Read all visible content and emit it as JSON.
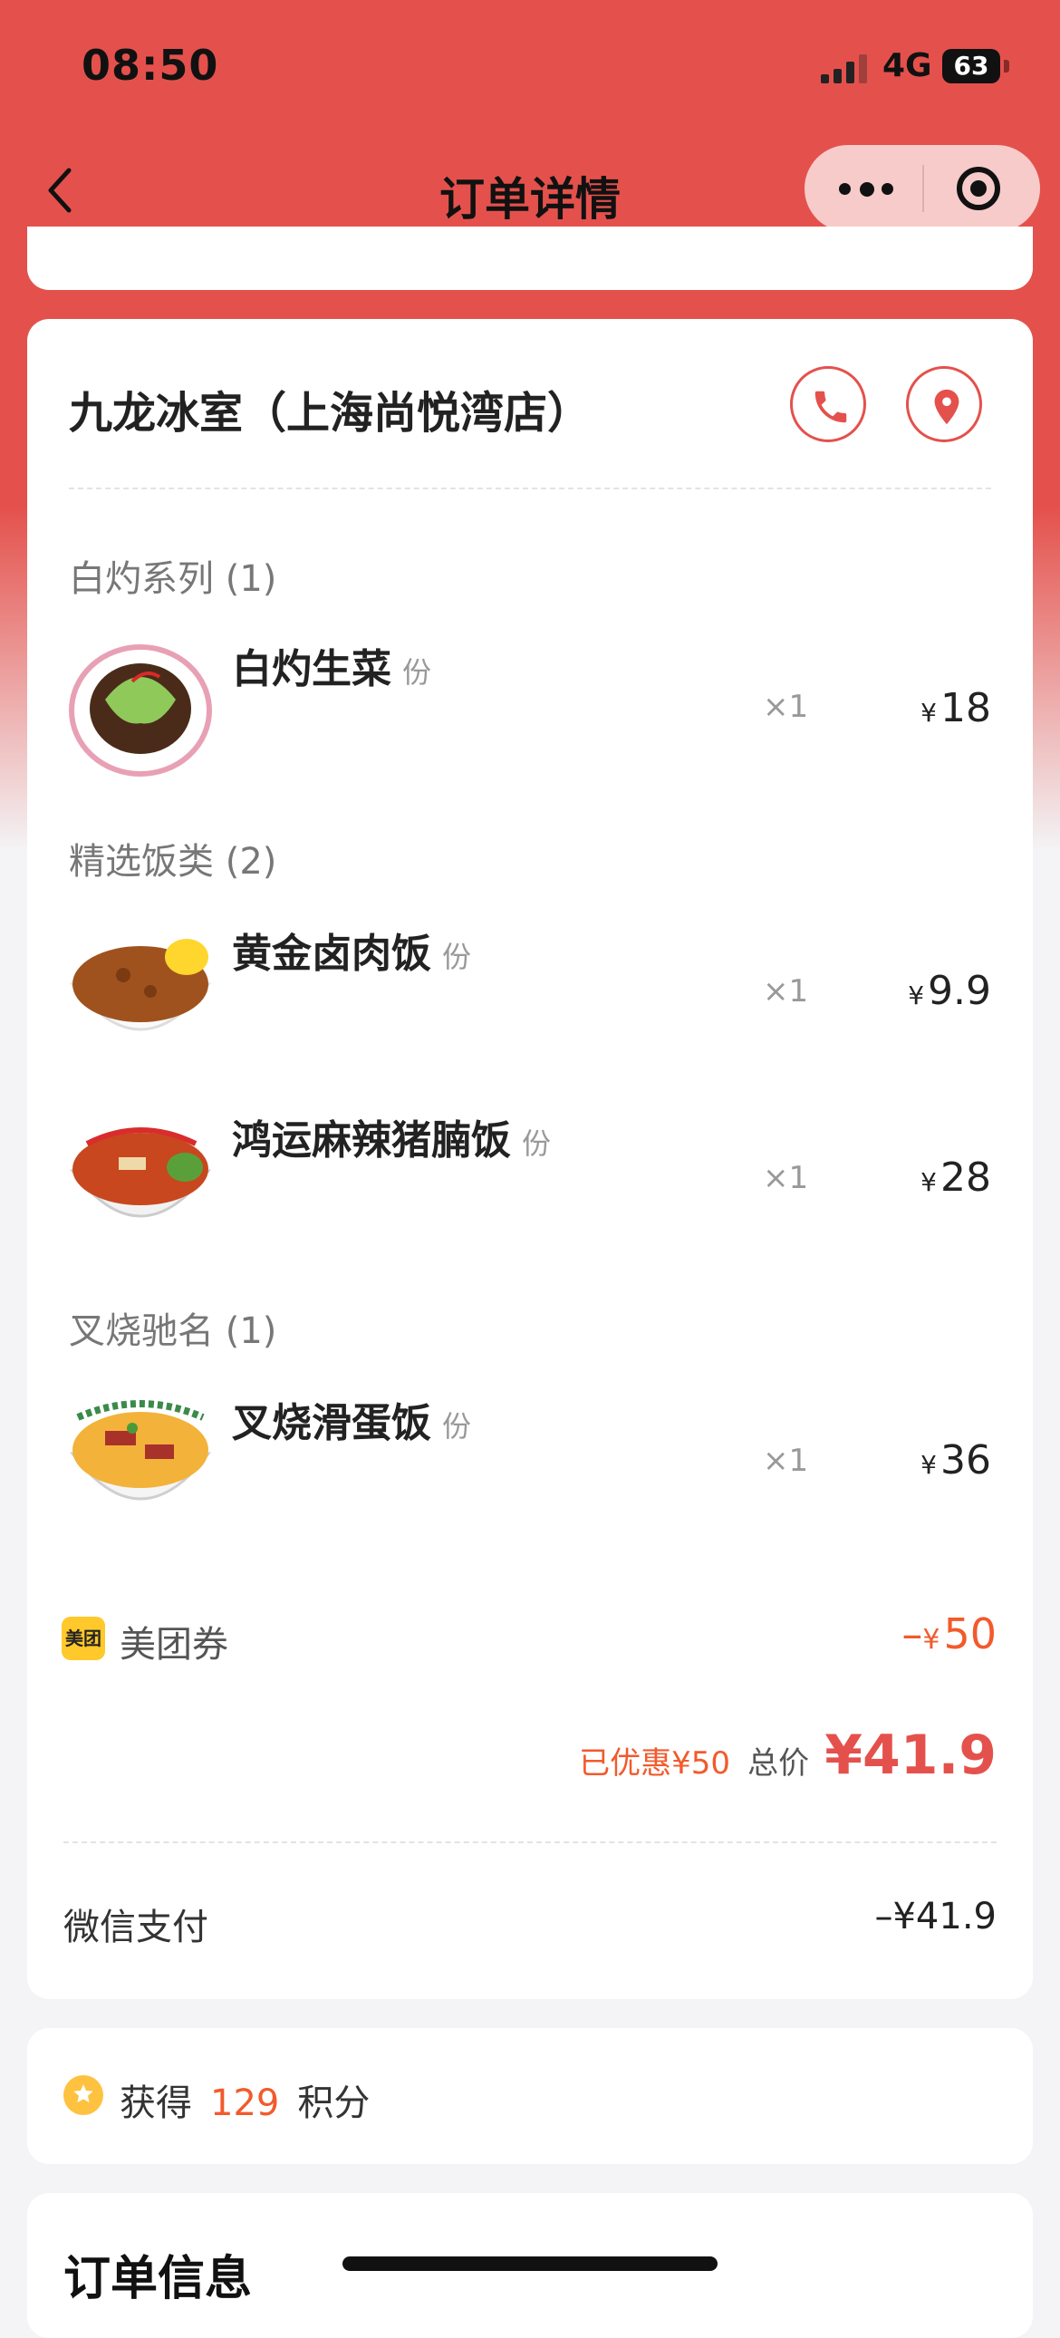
{
  "status_bar": {
    "time": "08:50",
    "network": "4G",
    "battery": "63"
  },
  "nav": {
    "title": "订单详情"
  },
  "colors": {
    "brand_red": "#e4514c",
    "accent_orange": "#f25a2c",
    "coupon_yellow": "#ffc82b"
  },
  "icons": [
    "back-icon",
    "more-icon",
    "target-icon",
    "phone-icon",
    "location-icon",
    "meituan-coupon-icon",
    "star-icon"
  ],
  "store": {
    "name": "九龙冰室（上海尚悦湾店）"
  },
  "sections": [
    {
      "title": "白灼系列 (1)",
      "items": [
        {
          "name": "白灼生菜",
          "unit": "份",
          "qty": "×1",
          "price": "18"
        }
      ]
    },
    {
      "title": "精选饭类 (2)",
      "items": [
        {
          "name": "黄金卤肉饭",
          "unit": "份",
          "qty": "×1",
          "price": "9.9"
        },
        {
          "name": "鸿运麻辣猪腩饭",
          "unit": "份",
          "qty": "×1",
          "price": "28"
        }
      ]
    },
    {
      "title": "叉烧驰名 (1)",
      "items": [
        {
          "name": "叉烧滑蛋饭",
          "unit": "份",
          "qty": "×1",
          "price": "36"
        }
      ]
    }
  ],
  "currency": "¥",
  "coupon": {
    "badge": "美团",
    "label": "美团券",
    "minus": "–",
    "amount": "50"
  },
  "summary": {
    "saved": "已优惠¥50",
    "total_label": "总价",
    "total": "¥41.9"
  },
  "payment": {
    "label": "微信支付",
    "amount": "–¥41.9"
  },
  "points": {
    "prefix": "获得",
    "value": "129",
    "suffix": "积分"
  },
  "order_info": {
    "title": "订单信息"
  }
}
